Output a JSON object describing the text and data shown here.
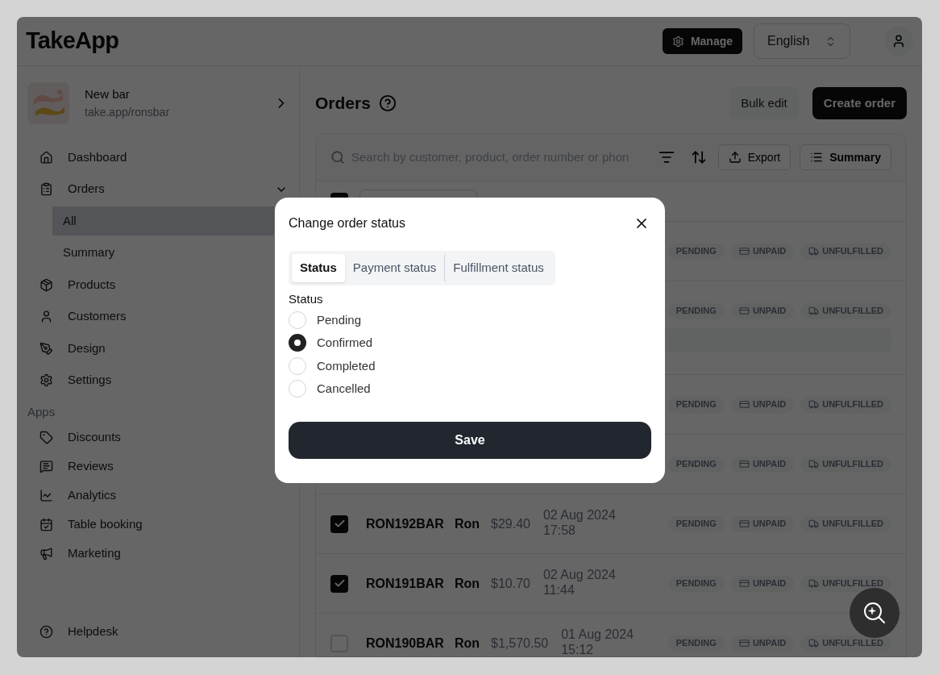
{
  "header": {
    "logo": "TakeApp",
    "manage_button": "Manage",
    "language": "English"
  },
  "shop": {
    "name": "New bar",
    "url": "take.app/ronsbar"
  },
  "nav": [
    {
      "label": "Dashboard"
    },
    {
      "label": "Orders",
      "expanded": true,
      "children": [
        {
          "label": "All",
          "selected": true
        },
        {
          "label": "Summary",
          "selected": false
        }
      ]
    },
    {
      "label": "Products"
    },
    {
      "label": "Customers"
    },
    {
      "label": "Design"
    },
    {
      "label": "Settings"
    }
  ],
  "apps_heading": "Apps",
  "apps": [
    {
      "label": "Discounts"
    },
    {
      "label": "Reviews"
    },
    {
      "label": "Analytics"
    },
    {
      "label": "Table booking"
    },
    {
      "label": "Marketing"
    }
  ],
  "helpdesk": "Helpdesk",
  "page": {
    "title": "Orders",
    "bulk_edit": "Bulk edit",
    "create_order": "Create order"
  },
  "toolbar": {
    "search_placeholder": "Search by customer, product, order number or phon",
    "export": "Export",
    "summary": "Summary"
  },
  "select_all": {
    "checked": true
  },
  "rows": [
    {
      "expanded": false,
      "badges": [
        "PENDING",
        "UNPAID",
        "UNFULFILLED"
      ]
    },
    {
      "expanded": true,
      "badges": [
        "PENDING",
        "UNPAID",
        "UNFULFILLED"
      ]
    },
    {
      "expanded": false,
      "badges": [
        "PENDING",
        "UNPAID",
        "UNFULFILLED"
      ]
    },
    {
      "expanded": false,
      "badges": [
        "PENDING",
        "UNPAID",
        "UNFULFILLED"
      ]
    },
    {
      "checked": true,
      "expanded": false,
      "order": "RON192BAR",
      "customer": "Ron",
      "amount": "$29.40",
      "date": "02 Aug 2024",
      "time": "17:58",
      "badges": [
        "PENDING",
        "UNPAID",
        "UNFULFILLED"
      ]
    },
    {
      "checked": true,
      "expanded": false,
      "order": "RON191BAR",
      "customer": "Ron",
      "amount": "$10.70",
      "date": "02 Aug 2024",
      "time": "11:44",
      "badges": [
        "PENDING",
        "UNPAID",
        "UNFULFILLED"
      ]
    },
    {
      "checked": false,
      "expanded": false,
      "order": "RON190BAR",
      "customer": "Ron",
      "amount": "$1,570.50",
      "date": "01 Aug 2024",
      "time": "15:12",
      "badges": [
        "PENDING",
        "UNPAID",
        "UNFULFILLED"
      ]
    }
  ],
  "dialog": {
    "title": "Change order status",
    "tabs": [
      {
        "label": "Status",
        "selected": true
      },
      {
        "label": "Payment status",
        "selected": false
      },
      {
        "label": "Fulfillment status",
        "selected": false
      }
    ],
    "group_label": "Status",
    "options": [
      {
        "label": "Pending",
        "selected": false
      },
      {
        "label": "Confirmed",
        "selected": true
      },
      {
        "label": "Completed",
        "selected": false
      },
      {
        "label": "Cancelled",
        "selected": false
      }
    ],
    "save": "Save"
  }
}
